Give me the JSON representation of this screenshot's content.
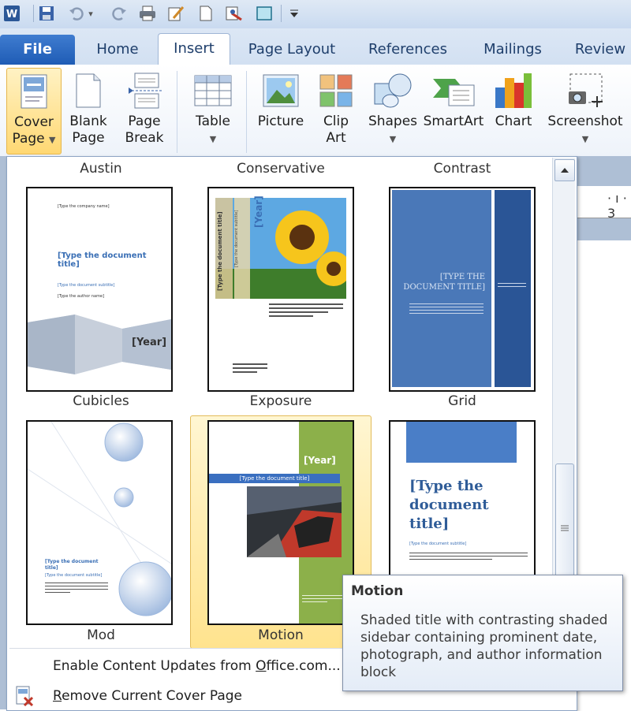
{
  "quick_access": {
    "icons": [
      "word-icon",
      "save-icon",
      "undo-icon",
      "redo-icon",
      "print-icon",
      "edit-icon",
      "new-doc-icon",
      "format-icon",
      "frame-icon",
      "customize-icon"
    ]
  },
  "tabs": [
    "File",
    "Home",
    "Insert",
    "Page Layout",
    "References",
    "Mailings",
    "Review"
  ],
  "ribbon": {
    "cover_page": {
      "line1": "Cover",
      "line2": "Page"
    },
    "blank_page": {
      "line1": "Blank",
      "line2": "Page"
    },
    "page_break": {
      "line1": "Page",
      "line2": "Break"
    },
    "table": {
      "line1": "Table"
    },
    "picture": {
      "line1": "Picture"
    },
    "clip_art": {
      "line1": "Clip",
      "line2": "Art"
    },
    "shapes": {
      "line1": "Shapes"
    },
    "smartart": {
      "line1": "SmartArt"
    },
    "chart": {
      "line1": "Chart"
    },
    "screenshot": {
      "line1": "Screenshot"
    }
  },
  "gallery": {
    "top_labels": [
      "Austin",
      "Conservative",
      "Contrast"
    ],
    "row1_labels": [
      "Cubicles",
      "Exposure",
      "Grid"
    ],
    "row2_labels": [
      "Mod",
      "Motion"
    ],
    "selected": "Motion",
    "thumb_text": {
      "company": "[Type the company name]",
      "doc_title": "[Type the document title]",
      "doc_subtitle": "[Type the document subtitle]",
      "author": "[Type the author name]",
      "year": "[Year]",
      "grid_title": "[TYPE THE DOCUMENT TITLE]",
      "title_multi": "[Type the document title]"
    }
  },
  "ruler_text": "· ı · 3",
  "menu": {
    "enable_updates": {
      "pre": "Enable Content Updates from ",
      "key": "O",
      "post": "ffice.com..."
    },
    "remove_cover": {
      "key": "R",
      "post": "emove Current Cover Page"
    }
  },
  "tooltip": {
    "title": "Motion",
    "body": "Shaded title with contrasting shaded sidebar containing prominent date, photograph, and author information block"
  },
  "colors": {
    "accent": "#1f5cb5",
    "selected_fill": "#ffd873",
    "grid_blue": "#4a78b8",
    "motion_green": "#8cb04a"
  }
}
